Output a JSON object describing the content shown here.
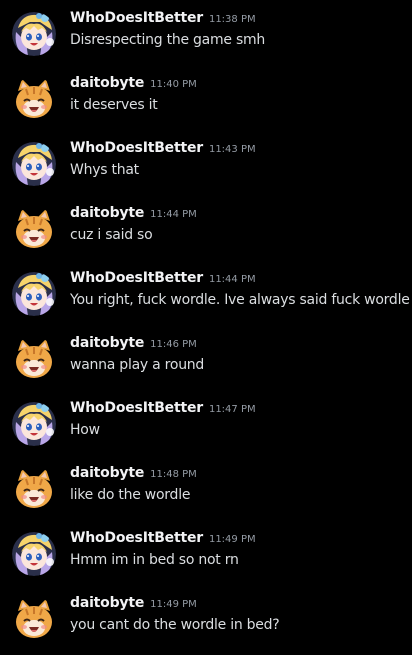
{
  "channel": {
    "messages": [
      {
        "author": "WhoDoesItBetter",
        "avatar_icon": "magical-girl-avatar-icon",
        "time": "11:38 PM",
        "text": "Disrespecting the game smh"
      },
      {
        "author": "daitobyte",
        "avatar_icon": "orange-cat-avatar-icon",
        "time": "11:40 PM",
        "text": "it deserves it"
      },
      {
        "author": "WhoDoesItBetter",
        "avatar_icon": "magical-girl-avatar-icon",
        "time": "11:43 PM",
        "text": "Whys that"
      },
      {
        "author": "daitobyte",
        "avatar_icon": "orange-cat-avatar-icon",
        "time": "11:44 PM",
        "text": "cuz i said so"
      },
      {
        "author": "WhoDoesItBetter",
        "avatar_icon": "magical-girl-avatar-icon",
        "time": "11:44 PM",
        "text": "You right, fuck wordle. Ive always said fuck wordle"
      },
      {
        "author": "daitobyte",
        "avatar_icon": "orange-cat-avatar-icon",
        "time": "11:46 PM",
        "text": "wanna play a round"
      },
      {
        "author": "WhoDoesItBetter",
        "avatar_icon": "magical-girl-avatar-icon",
        "time": "11:47 PM",
        "text": "How"
      },
      {
        "author": "daitobyte",
        "avatar_icon": "orange-cat-avatar-icon",
        "time": "11:48 PM",
        "text": "like do the wordle"
      },
      {
        "author": "WhoDoesItBetter",
        "avatar_icon": "magical-girl-avatar-icon",
        "time": "11:49 PM",
        "text": "Hmm im in bed so not rn"
      },
      {
        "author": "daitobyte",
        "avatar_icon": "orange-cat-avatar-icon",
        "time": "11:49 PM",
        "text": "you cant do the wordle in bed?"
      }
    ]
  },
  "colors": {
    "background": "#000000",
    "username": "#f2f3f5",
    "timestamp": "#949ba4",
    "message_text": "#dbdee1"
  }
}
